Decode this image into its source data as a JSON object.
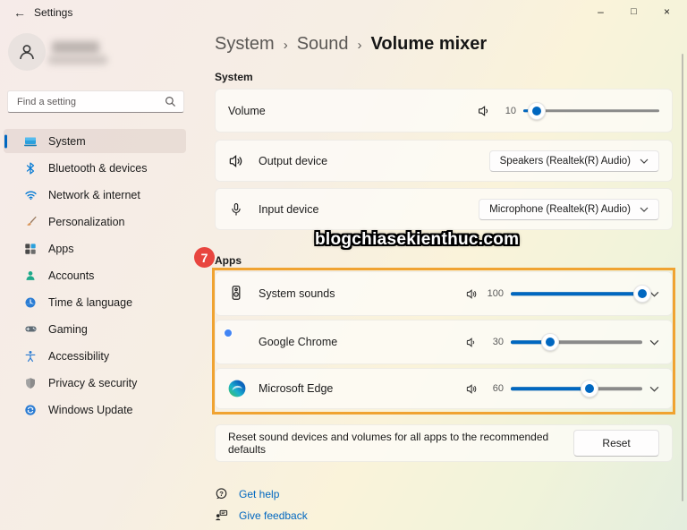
{
  "titlebar": {
    "title": "Settings"
  },
  "glyphs": {
    "back": "←",
    "minimize": "–",
    "maximize": "□",
    "close": "×",
    "separator": "›"
  },
  "search": {
    "placeholder": "Find a setting"
  },
  "sidebar": {
    "items": [
      {
        "label": "System",
        "icon": "system-icon",
        "selected": true
      },
      {
        "label": "Bluetooth & devices",
        "icon": "bluetooth-icon"
      },
      {
        "label": "Network & internet",
        "icon": "network-icon"
      },
      {
        "label": "Personalization",
        "icon": "personalization-icon"
      },
      {
        "label": "Apps",
        "icon": "apps-icon"
      },
      {
        "label": "Accounts",
        "icon": "accounts-icon"
      },
      {
        "label": "Time & language",
        "icon": "time-language-icon"
      },
      {
        "label": "Gaming",
        "icon": "gaming-icon"
      },
      {
        "label": "Accessibility",
        "icon": "accessibility-icon"
      },
      {
        "label": "Privacy & security",
        "icon": "privacy-icon"
      },
      {
        "label": "Windows Update",
        "icon": "windows-update-icon"
      }
    ]
  },
  "breadcrumb": {
    "parents": [
      "System",
      "Sound"
    ],
    "current": "Volume mixer"
  },
  "system_section": {
    "label": "System",
    "volume": {
      "label": "Volume",
      "value": 10
    },
    "output_device": {
      "label": "Output device",
      "selected": "Speakers (Realtek(R) Audio)"
    },
    "input_device": {
      "label": "Input device",
      "selected": "Microphone (Realtek(R) Audio)"
    }
  },
  "watermark": "blogchiasekienthuc.com",
  "apps_section": {
    "label": "Apps",
    "annotation_number": "7",
    "apps": [
      {
        "name": "System sounds",
        "volume": 100
      },
      {
        "name": "Google Chrome",
        "volume": 30
      },
      {
        "name": "Microsoft Edge",
        "volume": 60
      }
    ]
  },
  "reset": {
    "description": "Reset sound devices and volumes for all apps to the recommended defaults",
    "button_label": "Reset"
  },
  "footer": {
    "links": [
      {
        "label": "Get help"
      },
      {
        "label": "Give feedback"
      }
    ]
  },
  "colors": {
    "accent": "#0067c0",
    "annotation": "#f0a331",
    "badge": "#e8453f",
    "link": "#0067c0"
  }
}
